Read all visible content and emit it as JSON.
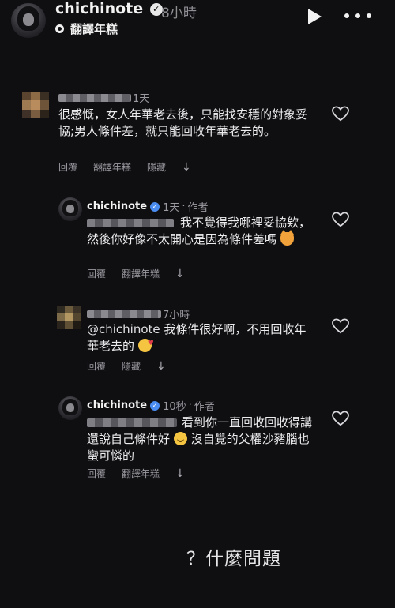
{
  "header": {
    "username": "chichinote",
    "time": "8小時",
    "translate_label": "翻譯年糕",
    "verified_mark": "✓"
  },
  "comments": [
    {
      "time": "1天",
      "text": "很感慨，女人年華老去後，只能找安穩的對象妥協;男人條件差，就只能回收年華老去的。",
      "actions": [
        "回覆",
        "翻譯年糕",
        "隱藏"
      ]
    },
    {
      "username": "chichinote",
      "time": "1天",
      "author_tag": "作者",
      "text": "我不覺得我哪裡妥協欸，然後你好像不太開心是因為條件差嗎",
      "actions": [
        "回覆",
        "翻譯年糕"
      ]
    },
    {
      "time": "7小時",
      "mention": "@chichinote",
      "text": "我條件很好啊，不用回收年華老去的",
      "actions": [
        "回覆",
        "隱藏"
      ]
    },
    {
      "username": "chichinote",
      "time": "10秒",
      "author_tag": "作者",
      "text": "看到你一直回收回收得講還說自己條件好",
      "text_after_emoji": "沒自覺的父權沙豬腦也蠻可憐的",
      "actions": [
        "回覆",
        "翻譯年糕"
      ]
    }
  ],
  "caption": "？什麼問題",
  "icons": {
    "play": "play-icon",
    "more": "more-icon",
    "heart": "heart-outline-icon",
    "expand": "chevron-down-icon"
  },
  "colors": {
    "background": "#0f0f12",
    "text": "#ececee",
    "muted": "#9a9aa0"
  }
}
